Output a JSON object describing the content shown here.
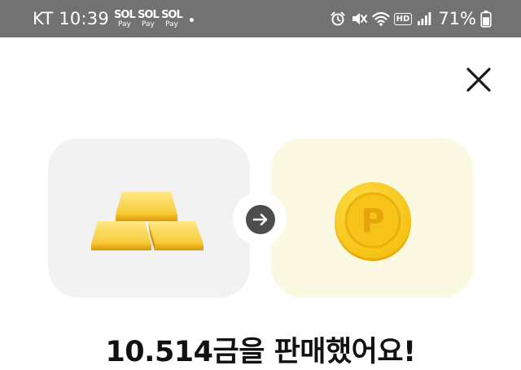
{
  "status_bar": {
    "carrier": "KT",
    "time": "10:39",
    "pay_icons": [
      {
        "brand": "SOL",
        "label": "Pay"
      },
      {
        "brand": "SOL",
        "label": "Pay"
      },
      {
        "brand": "SOL",
        "label": "Pay"
      }
    ],
    "right_icons": [
      "alarm-icon",
      "mute-icon",
      "wifi-icon",
      "hd-voice-icon",
      "signal-icon"
    ],
    "hd_label": "HD",
    "battery_percent": "71%",
    "battery_level": 0.71
  },
  "dialog": {
    "close_icon": "close-icon",
    "from_item": {
      "icon": "gold-bars-icon"
    },
    "arrow_icon": "arrow-right-icon",
    "to_item": {
      "icon": "point-coin-icon",
      "coin_letter": "P"
    },
    "headline": "10.514금을 판매했어요!"
  },
  "colors": {
    "status_bar_bg": "#727272",
    "gold_card_bg": "#f2f2f2",
    "point_card_bg": "#fcf9e2",
    "arrow_circle": "#4d4d4d",
    "coin_yellow": "#f7c81b"
  }
}
